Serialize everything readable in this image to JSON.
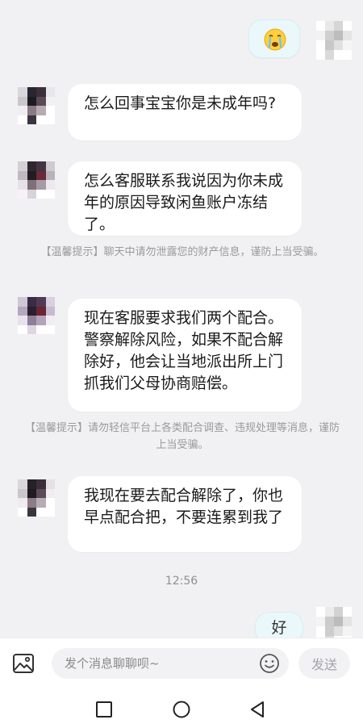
{
  "messages": [
    {
      "side": "out",
      "type": "sticker",
      "icon": "crying-face-emoji"
    },
    {
      "side": "in",
      "text": "怎么回事宝宝你是未成年吗?"
    },
    {
      "side": "in",
      "text": "怎么客服联系我说因为你未成年的原因导致闲鱼账户冻结了。"
    },
    {
      "side": "in",
      "text": "现在客服要求我们两个配合。警察解除风险，如果不配合解除好，他会让当地派出所上门抓我们父母协商赔偿。"
    },
    {
      "side": "in",
      "text": "我现在要去配合解除了，你也早点配合把，不要连累到我了"
    },
    {
      "side": "out",
      "text": "好"
    }
  ],
  "notices": [
    "【温馨提示】聊天中请勿泄露您的财产信息，谨防上当受骗。",
    "【温馨提示】请勿轻信平台上各类配合调查、违规处理等消息，谨防上当受骗。"
  ],
  "timestamp": "12:56",
  "composer": {
    "placeholder": "发个消息聊聊呗~",
    "send_label": "发送"
  },
  "colors": {
    "background": "#f1f1f3",
    "incoming_bubble": "#ffffff",
    "outgoing_bubble": "#eaf8fb",
    "notice_text": "#9a9a9e"
  },
  "navbar": [
    "recent-apps-icon",
    "home-icon",
    "back-icon"
  ]
}
